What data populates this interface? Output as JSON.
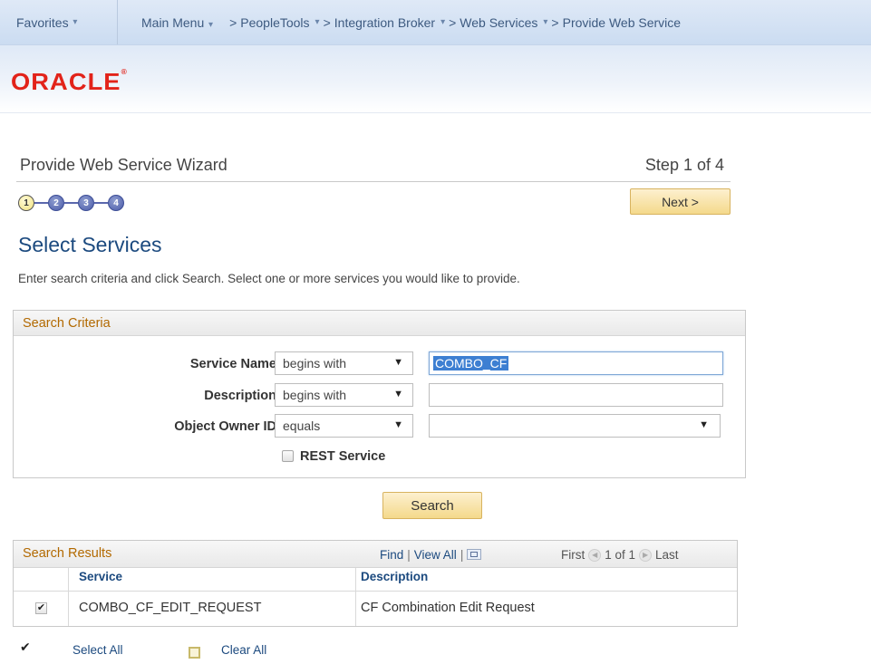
{
  "nav": {
    "favorites": "Favorites",
    "main_menu": "Main Menu",
    "crumbs": [
      "PeopleTools",
      "Integration Broker",
      "Web Services",
      "Provide Web Service"
    ]
  },
  "brand": {
    "logo": "ORACLE"
  },
  "wizard": {
    "title": "Provide Web Service Wizard",
    "step_indicator": "Step 1 of 4",
    "steps": [
      "1",
      "2",
      "3",
      "4"
    ],
    "next_label": "Next >"
  },
  "page": {
    "heading": "Select Services",
    "instructions": "Enter search criteria and click Search. Select one or more services you would like to provide."
  },
  "criteria": {
    "title": "Search Criteria",
    "service_name": {
      "label": "Service Name",
      "operator": "begins with",
      "value": "COMBO_CF"
    },
    "description": {
      "label": "Description",
      "operator": "begins with",
      "value": ""
    },
    "object_owner": {
      "label": "Object Owner ID",
      "operator": "equals",
      "value": ""
    },
    "rest_label": "REST Service",
    "search_label": "Search"
  },
  "results": {
    "title": "Search Results",
    "find": "Find",
    "view_all": "View All",
    "first": "First",
    "page_info": "1 of 1",
    "last": "Last",
    "columns": [
      "Service",
      "Description"
    ],
    "rows": [
      {
        "service": "COMBO_CF_EDIT_REQUEST",
        "description": "CF Combination Edit Request",
        "checked": true
      }
    ]
  },
  "actions": {
    "select_all": "Select All",
    "clear_all": "Clear All"
  },
  "colors": {
    "link": "#1c4a7f",
    "header_orange": "#b26900",
    "oracle_red": "#e2231a"
  }
}
